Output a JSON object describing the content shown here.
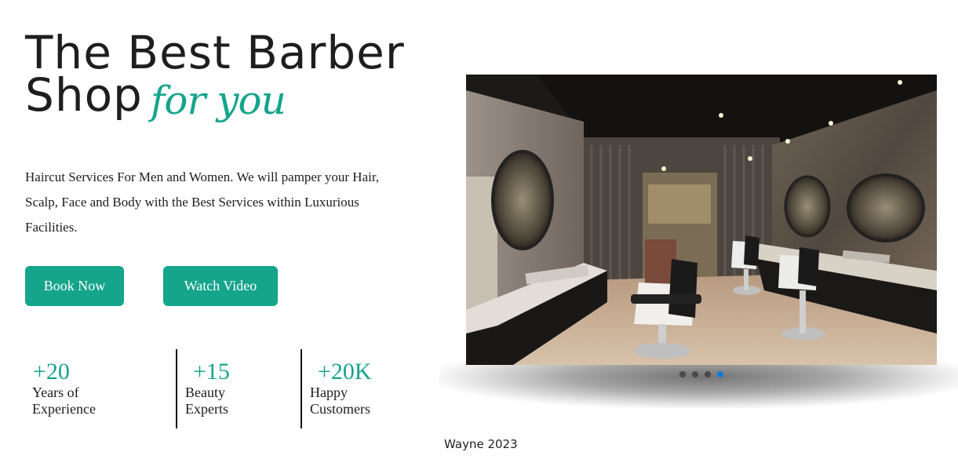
{
  "hero": {
    "title_line1": "The Best Barber",
    "title_line2": "Shop",
    "title_accent": "for you",
    "description": "Haircut Services For Men and Women. We will pamper your Hair, Scalp, Face and Body with the Best Services within Luxurious Facilities."
  },
  "buttons": {
    "book_label": "Book Now",
    "watch_label": "Watch Video"
  },
  "stats": [
    {
      "value": "+20",
      "label": "Years of Experience"
    },
    {
      "value": "+15",
      "label": "Beauty Experts"
    },
    {
      "value": "+20K",
      "label": "Happy Customers"
    }
  ],
  "carousel": {
    "image_subject": "barber shop interior",
    "slide_count": 4,
    "active_slide": 4
  },
  "footer": {
    "text": "Wayne 2023"
  },
  "colors": {
    "accent": "#14a58b",
    "active_dot": "#1177dd"
  }
}
